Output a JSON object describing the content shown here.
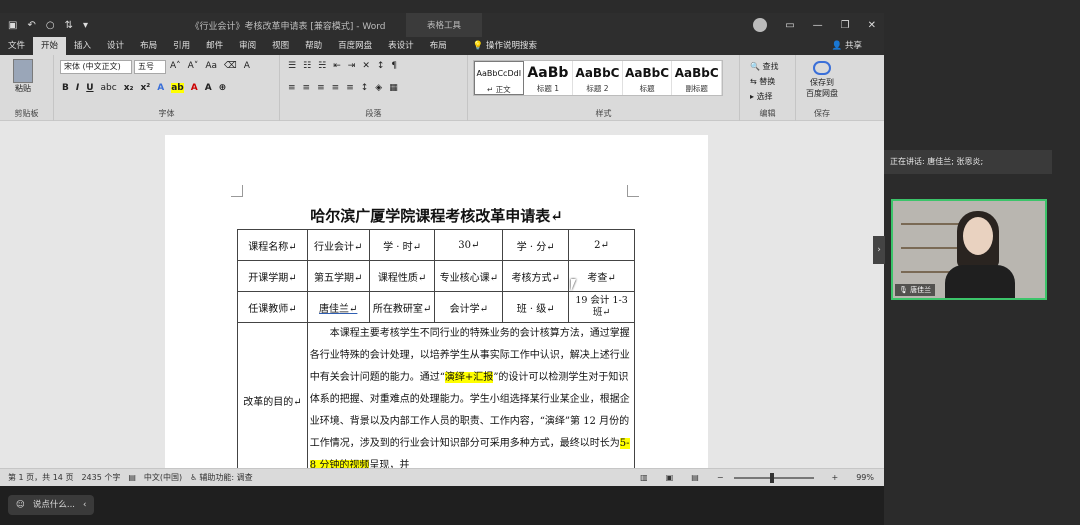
{
  "window": {
    "doc_title": "《行业会计》考核改革申请表 [兼容模式] - Word",
    "context_tool": "表格工具",
    "user_initials": "",
    "share": "共享"
  },
  "tabs": [
    "文件",
    "开始",
    "插入",
    "设计",
    "布局",
    "引用",
    "邮件",
    "审阅",
    "视图",
    "帮助",
    "百度网盘",
    "表设计",
    "布局"
  ],
  "tab_search": "操作说明搜索",
  "ribbon": {
    "paste": "粘贴",
    "clipboard_label": "剪贴板",
    "font_name": "宋体 (中文正文)",
    "font_size": "五号",
    "font_label": "字体",
    "paragraph_label": "段落",
    "styles_label": "样式",
    "editing_label": "编辑",
    "save_label": "保存",
    "styles": [
      {
        "preview": "AaBbCcDdI",
        "name": "↵ 正文"
      },
      {
        "preview": "AaBb",
        "name": "标题 1"
      },
      {
        "preview": "AaBbC",
        "name": "标题 2"
      },
      {
        "preview": "AaBbC",
        "name": "标题"
      },
      {
        "preview": "AaBbC",
        "name": "副标题"
      }
    ],
    "find": "查找",
    "replace": "替换",
    "select": "选择",
    "save_to": "保存到",
    "baidu": "百度网盘"
  },
  "document": {
    "heading": "哈尔滨广厦学院课程考核改革申请表↵",
    "rows": [
      [
        "课程名称↵",
        "行业会计↵",
        "学 · 时↵",
        "30↵",
        "学 · 分↵",
        "2↵"
      ],
      [
        "开课学期↵",
        "第五学期↵",
        "课程性质↵",
        "专业核心课↵",
        "考核方式↵",
        "考查↵"
      ],
      [
        "任课教师↵",
        "唐佳兰↵",
        "所在教研室↵",
        "会计学↵",
        "班 · 级↵",
        "19 会计 1-3 班↵"
      ]
    ],
    "purpose_label": "改革的目的↵",
    "essay_part1": "本课程主要考核学生不同行业的特殊业务的会计核算方法，通过掌握各行业特殊的会计处理，以培养学生从事实际工作中认识，解决上述行业中有关会计问题的能力。通过“",
    "essay_hl1": "演绎+汇报",
    "essay_part2": "”的设计可以检测学生对于知识体系的把握、对重难点的处理能力。学生小组选择某行业某企业，根据企业环境、背景以及内部工作人员的职责、工作内容，“演绎”第 12 月份的工作情况，涉及到的行业会计知识部分可采用多种方式，最终以时长为",
    "essay_hl2": "5-8 分钟的视频",
    "essay_part3": "呈现，并"
  },
  "status": {
    "page": "第 1 页，共 14 页",
    "words": "2435 个字",
    "lang": "中文(中国)",
    "accessibility": "辅助功能: 调查",
    "zoom": "99%"
  },
  "meeting": {
    "speaking": "正在讲话: 唐佳兰; 张恩炎;",
    "tile_name": "唐佳兰",
    "say_placeholder": "说点什么..."
  }
}
